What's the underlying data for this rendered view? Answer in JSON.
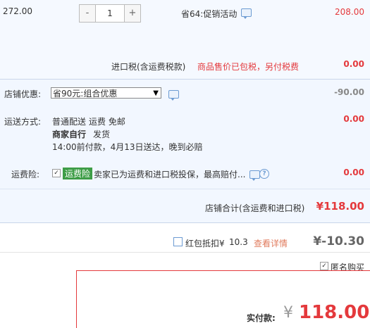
{
  "item": {
    "unit_price": "272.00",
    "minus": "-",
    "quantity": "1",
    "plus": "+",
    "promo": "省64:促销活动",
    "subtotal": "208.00"
  },
  "import_tax": {
    "label": "进口税(含运费税款)",
    "note": "商品售价已包税，另付税费",
    "value": "0.00"
  },
  "store_discount": {
    "label": "店铺优惠:",
    "selected": "省90元:组合优惠",
    "value": "-90.00"
  },
  "shipping": {
    "label": "运送方式:",
    "method": "普通配送",
    "fee_text": "运费 免邮",
    "seller": "商家自行",
    "ship_text": "发货",
    "delivery": "14:00前付款，4月13日送达，晚到必赔",
    "value": "0.00"
  },
  "insurance": {
    "label": "运费险:",
    "badge": "运费险",
    "desc": "卖家已为运费和进口税投保，最高赔付...",
    "value": "0.00"
  },
  "store_total": {
    "label": "店铺合计(含运费和进口税)",
    "value": "¥118.00"
  },
  "red_packet": {
    "label": "红包抵扣¥",
    "amount": "10.3",
    "link": "查看详情",
    "value": "¥-10.30"
  },
  "anonymous": {
    "label": "匿名购买"
  },
  "payment": {
    "label": "实付款:",
    "currency": "¥",
    "amount": "118.00"
  },
  "colors": {
    "accent": "#e4393c",
    "panel": "#f2f7ff",
    "link": "#6c9bd2",
    "badge": "#3e9d47"
  }
}
